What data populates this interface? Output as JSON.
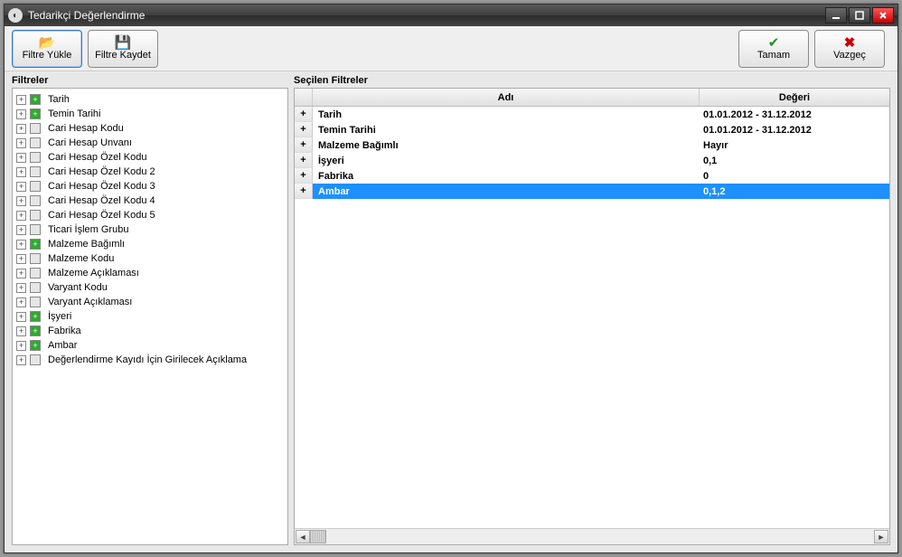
{
  "window": {
    "title": "Tedarikçi Değerlendirme"
  },
  "toolbar": {
    "load_label": "Filtre Yükle",
    "save_label": "Filtre Kaydet",
    "ok_label": "Tamam",
    "cancel_label": "Vazgeç"
  },
  "left_panel": {
    "title": "Filtreler",
    "items": [
      {
        "label": "Tarih",
        "active": true
      },
      {
        "label": "Temin Tarihi",
        "active": true
      },
      {
        "label": "Cari Hesap Kodu",
        "active": false
      },
      {
        "label": "Cari Hesap Unvanı",
        "active": false
      },
      {
        "label": "Cari Hesap Özel Kodu",
        "active": false
      },
      {
        "label": "Cari Hesap Özel Kodu 2",
        "active": false
      },
      {
        "label": "Cari Hesap Özel Kodu 3",
        "active": false
      },
      {
        "label": "Cari Hesap Özel Kodu 4",
        "active": false
      },
      {
        "label": "Cari Hesap Özel Kodu 5",
        "active": false
      },
      {
        "label": "Ticari İşlem Grubu",
        "active": false
      },
      {
        "label": "Malzeme Bağımlı",
        "active": true
      },
      {
        "label": "Malzeme Kodu",
        "active": false
      },
      {
        "label": "Malzeme Açıklaması",
        "active": false
      },
      {
        "label": "Varyant Kodu",
        "active": false
      },
      {
        "label": "Varyant Açıklaması",
        "active": false
      },
      {
        "label": "İşyeri",
        "active": true
      },
      {
        "label": "Fabrika",
        "active": true
      },
      {
        "label": "Ambar",
        "active": true
      },
      {
        "label": "Değerlendirme Kayıdı İçin Girilecek Açıklama",
        "active": false
      }
    ]
  },
  "right_panel": {
    "title": "Seçilen Filtreler",
    "columns": {
      "name": "Adı",
      "value": "Değeri"
    },
    "rows": [
      {
        "name": "Tarih",
        "value": "01.01.2012 - 31.12.2012",
        "selected": false
      },
      {
        "name": "Temin Tarihi",
        "value": "01.01.2012 - 31.12.2012",
        "selected": false
      },
      {
        "name": "Malzeme Bağımlı",
        "value": "Hayır",
        "selected": false
      },
      {
        "name": "İşyeri",
        "value": "0,1",
        "selected": false
      },
      {
        "name": "Fabrika",
        "value": "0",
        "selected": false
      },
      {
        "name": "Ambar",
        "value": "0,1,2",
        "selected": true
      }
    ]
  }
}
